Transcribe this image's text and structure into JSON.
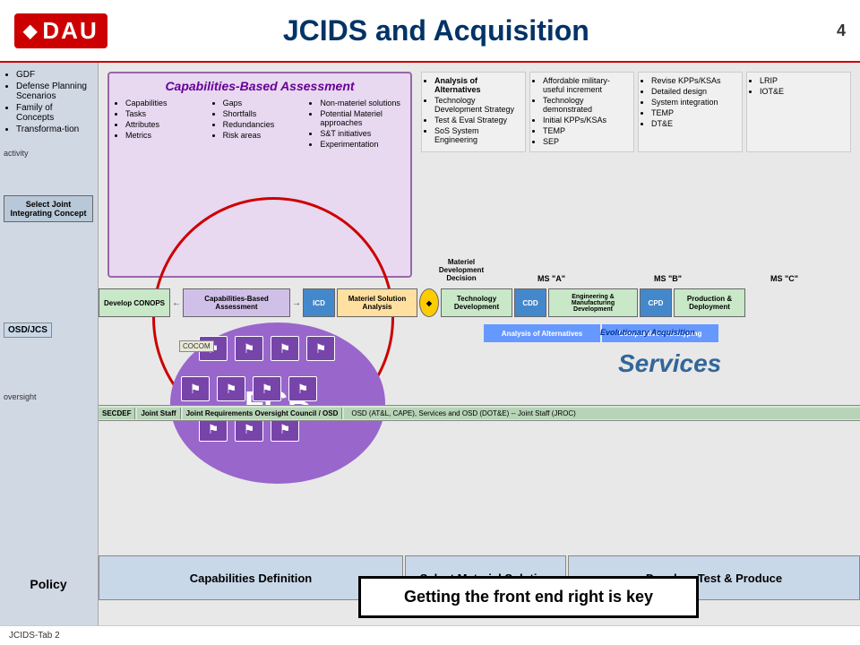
{
  "header": {
    "title": "JCIDS and Acquisition",
    "page_number": "4",
    "logo_text": "DAU",
    "tab_label": "JCIDS-Tab 2"
  },
  "left_col": {
    "items": [
      "GDF",
      "Defense Planning Scenarios",
      "Family of Concepts",
      "Transformation"
    ],
    "activity_label": "activity",
    "select_joint_label": "Select Joint Integrating Concept",
    "osd_jcs_label": "OSD/JCS",
    "oversight_label": "oversight",
    "policy_label": "Policy",
    "cocom_label": "COCOM"
  },
  "cba": {
    "title": "Capabilities-Based Assessment",
    "col1_header": "Capabilities",
    "col1_items": [
      "Capabilities",
      "Tasks",
      "Attributes",
      "Metrics"
    ],
    "col2_header": "Gaps",
    "col2_items": [
      "Gaps",
      "Shortfalls",
      "Redundancies",
      "Risk areas"
    ],
    "col3_header": "Non-materiel solutions",
    "col3_items": [
      "Non-materiel solutions",
      "Potential Materiel approaches",
      "S&T initiatives",
      "Experimentation"
    ]
  },
  "right_cols": [
    {
      "items": [
        "Analysis of Alternatives",
        "Technology Development Strategy",
        "Test & Eval Strategy",
        "SoS System Engineering"
      ],
      "label": "Materiel Development Decision"
    },
    {
      "items": [
        "Affordable military-useful increment",
        "Technology demonstrated",
        "Initial KPPs/KSAs",
        "TEMP",
        "SEP"
      ],
      "label": "MS \"A\""
    },
    {
      "items": [
        "Revise KPPs/KSAs",
        "Detailed design",
        "System integration",
        "TEMP",
        "DT&E"
      ],
      "label": "MS \"B\""
    },
    {
      "items": [
        "LRIP",
        "IOT&E"
      ],
      "label": "MS \"C\""
    }
  ],
  "process_row": {
    "develop_conops": "Develop CONOPS",
    "cba_arrow": "Capabilities-Based Assessment",
    "icd": "ICD",
    "msa": "Materiel Solution Analysis",
    "td": "Technology Development",
    "cdd": "CDD",
    "emd": "Engineering & Manufacturing Development",
    "cpd": "CPD",
    "pd": "Production & Deployment"
  },
  "ms_labels": {
    "ms_a": "MS \"A\"",
    "ms_b": "MS \"B\"",
    "ms_c": "MS \"C\"",
    "mdd": "Materiel Development Decision"
  },
  "phases": {
    "aoa": "Analysis of Alternatives",
    "cp": "Competitive Prototyping",
    "ea": "Evolutionary Acquisition"
  },
  "fcb": {
    "label": "FCB"
  },
  "services_label": "Services",
  "bottom_phases": {
    "cap_def": "Capabilities Definition",
    "sms": "Select Materiel Solution",
    "dtp": "Develop, Test & Produce"
  },
  "key_statement": "Getting the front end right is key",
  "oversight_row": {
    "secdef": "SECDEF",
    "joint_staff": "Joint Staff",
    "jroc": "Joint Requirements Oversight Council / OSD",
    "osd": "OSD (AT&L, CAPE), Services and OSD (DOT&E) -- Joint Staff (JROC)"
  }
}
